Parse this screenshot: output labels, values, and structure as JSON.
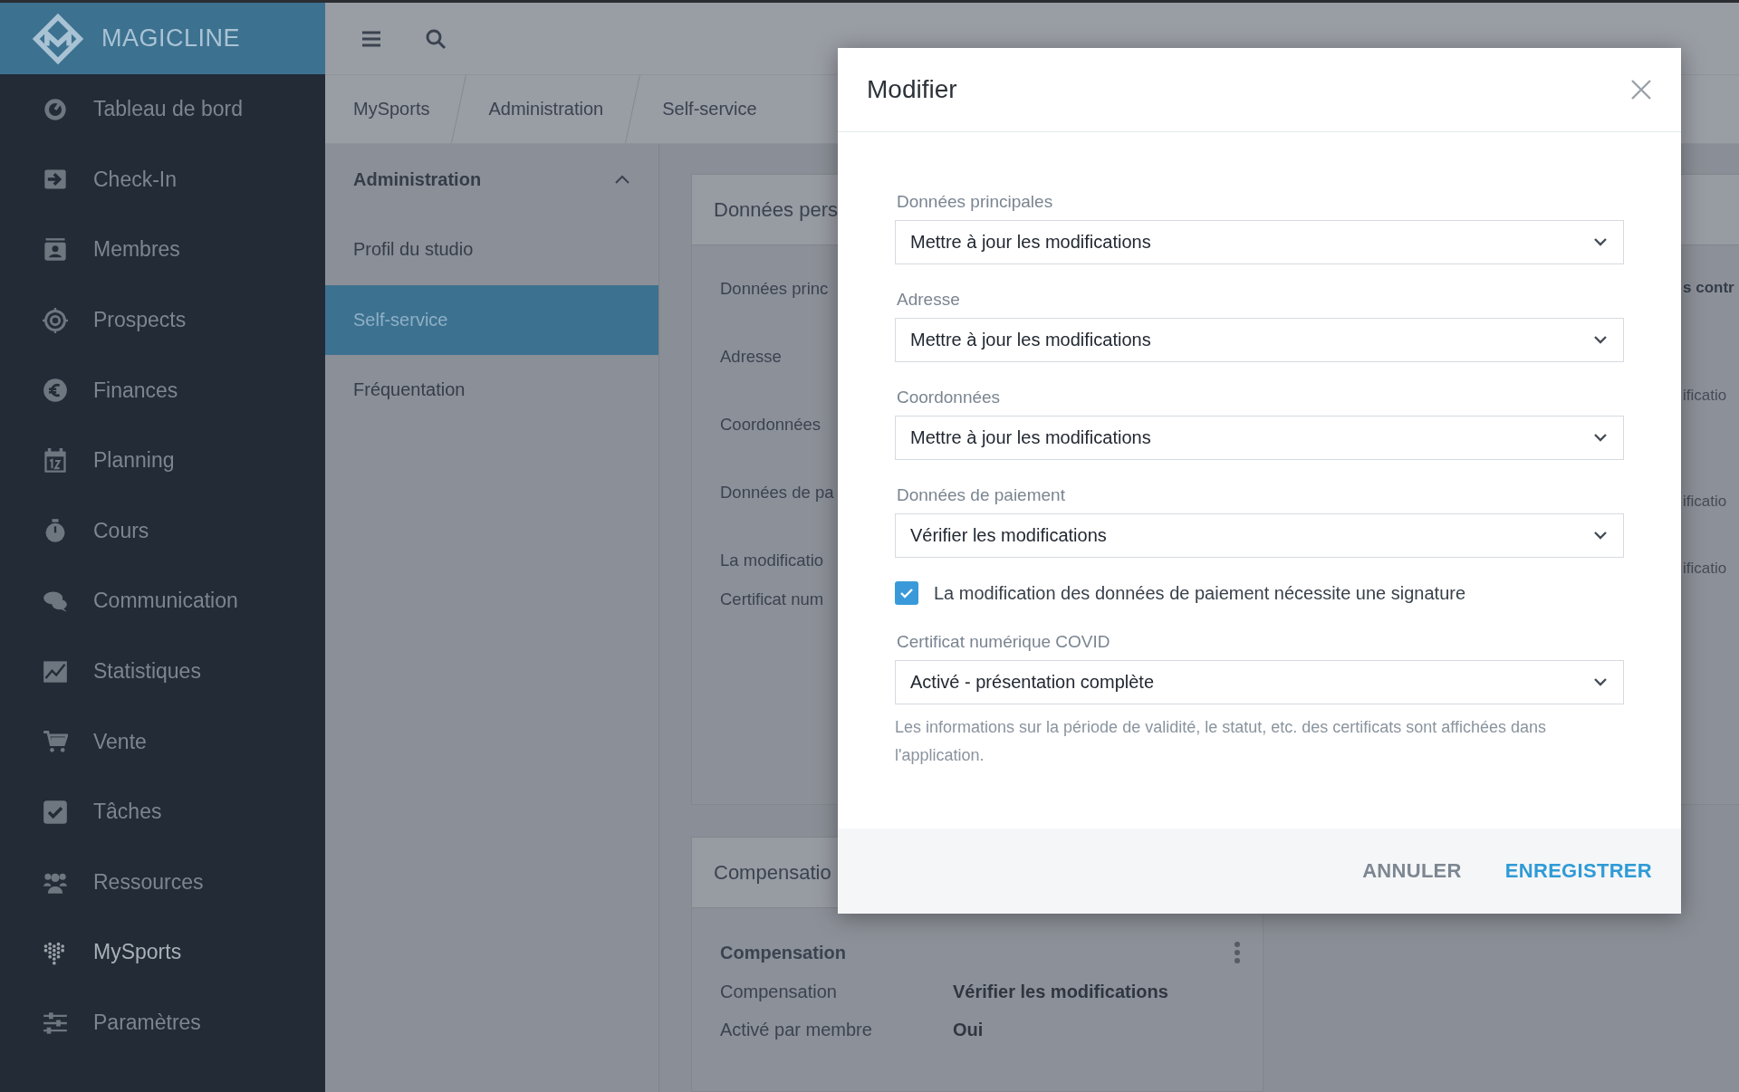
{
  "sidebar": {
    "brand": "MAGICLINE",
    "items": [
      {
        "label": "Tableau de bord",
        "selected": false
      },
      {
        "label": "Check-In",
        "selected": false
      },
      {
        "label": "Membres",
        "selected": false
      },
      {
        "label": "Prospects",
        "selected": false
      },
      {
        "label": "Finances",
        "selected": false
      },
      {
        "label": "Planning",
        "selected": false
      },
      {
        "label": "Cours",
        "selected": false
      },
      {
        "label": "Communication",
        "selected": false
      },
      {
        "label": "Statistiques",
        "selected": false
      },
      {
        "label": "Vente",
        "selected": false
      },
      {
        "label": "Tâches",
        "selected": false
      },
      {
        "label": "Ressources",
        "selected": false
      },
      {
        "label": "MySports",
        "selected": true
      },
      {
        "label": "Paramètres",
        "selected": false
      }
    ]
  },
  "breadcrumb": [
    "MySports",
    "Administration",
    "Self-service"
  ],
  "subnav": {
    "title": "Administration",
    "expanded": true,
    "items": [
      {
        "label": "Profil du studio",
        "selected": false
      },
      {
        "label": "Self-service",
        "selected": true
      },
      {
        "label": "Fréquentation",
        "selected": false
      }
    ]
  },
  "settings_card": {
    "title": "Données pers",
    "rows": [
      "Données princ",
      "Adresse",
      "Coordonnées",
      "Données de pa",
      "La modificatio",
      "Certificat num"
    ],
    "right_column": [
      {
        "text": "s contr",
        "kind": "heading"
      },
      {
        "text": "ificatio",
        "kind": "value"
      },
      {
        "text": "ificatio",
        "kind": "value"
      },
      {
        "text": "ificatio",
        "kind": "value"
      }
    ]
  },
  "compensation_card": {
    "title": "Compensatio",
    "section": "Compensation",
    "rows": [
      {
        "label": "Compensation",
        "value": "Vérifier les modifications"
      },
      {
        "label": "Activé par membre",
        "value": "Oui"
      }
    ]
  },
  "dialog": {
    "title": "Modifier",
    "fields": [
      {
        "kind": "select",
        "label": "Données principales",
        "value": "Mettre à jour les modifications"
      },
      {
        "kind": "select",
        "label": "Adresse",
        "value": "Mettre à jour les modifications"
      },
      {
        "kind": "select",
        "label": "Coordonnées",
        "value": "Mettre à jour les modifications"
      },
      {
        "kind": "select",
        "label": "Données de paiement",
        "value": "Vérifier les modifications"
      },
      {
        "kind": "checkbox",
        "label": "La modification des données de paiement nécessite une signature",
        "checked": true
      },
      {
        "kind": "select",
        "label": "Certificat numérique COVID",
        "value": "Activé - présentation complète",
        "help": "Les informations sur la période de validité, le statut, etc. des certificats sont affichées dans l'application."
      }
    ],
    "buttons": [
      {
        "label": "ANNULER",
        "kind": "secondary"
      },
      {
        "label": "ENREGISTRER",
        "kind": "primary"
      }
    ]
  }
}
